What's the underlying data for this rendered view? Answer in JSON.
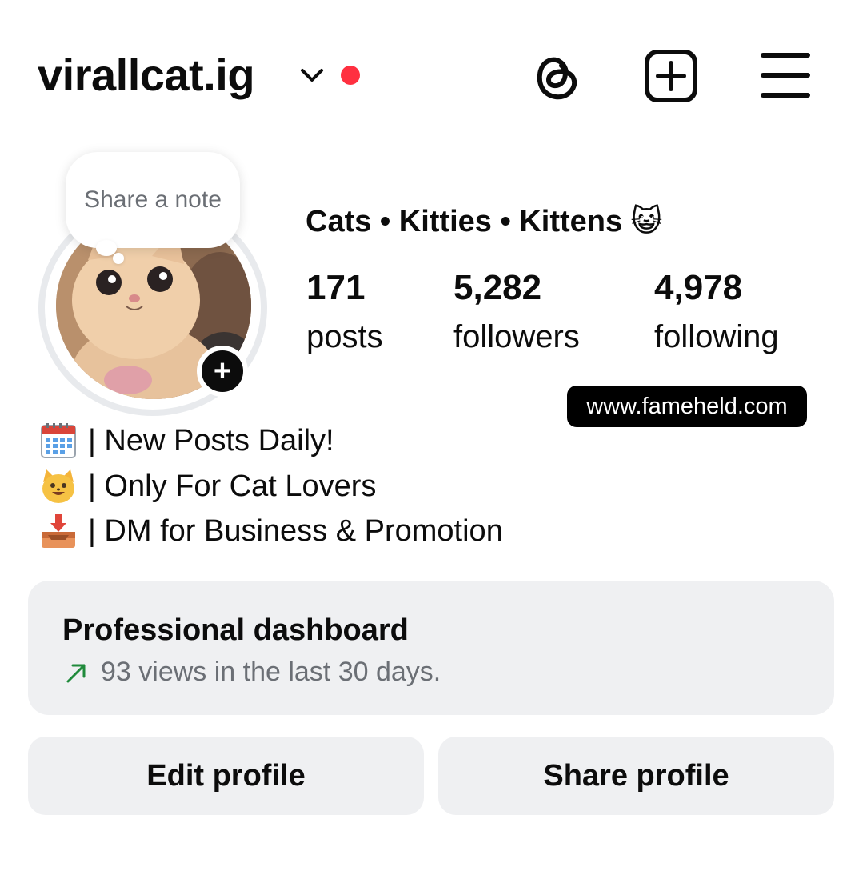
{
  "header": {
    "username": "virallcat.ig",
    "colors": {
      "notification_dot": "#ff3040"
    },
    "icons": [
      "chevron-down-icon",
      "threads-icon",
      "create-post-icon",
      "menu-icon"
    ]
  },
  "note": {
    "text": "Share a note"
  },
  "profile": {
    "display_name": "Cats • Kitties • Kittens 😺",
    "stats": [
      {
        "value": "171",
        "label": "posts"
      },
      {
        "value": "5,282",
        "label": "followers"
      },
      {
        "value": "4,978",
        "label": "following"
      }
    ]
  },
  "watermark": "www.fameheld.com",
  "bio": [
    {
      "icon": "calendar-icon",
      "text": "| New Posts Daily!"
    },
    {
      "icon": "cat-face-icon",
      "text": "| Only For Cat Lovers"
    },
    {
      "icon": "inbox-tray-icon",
      "text": "| DM for Business & Promotion"
    }
  ],
  "dashboard": {
    "title": "Professional dashboard",
    "subtitle": "93 views in the last 30 days.",
    "colors": {
      "arrow": "#1f8a3b"
    }
  },
  "buttons": {
    "edit_profile": "Edit profile",
    "share_profile": "Share profile"
  }
}
